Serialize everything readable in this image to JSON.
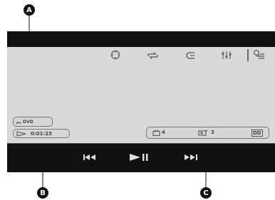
{
  "callouts": {
    "a": "A",
    "b": "B",
    "c": "C"
  },
  "disc": {
    "label": "DVD"
  },
  "status": {
    "elapsed": "0:01:23"
  },
  "info": {
    "title_count": "4",
    "chapter_number": "3",
    "format": "DD"
  },
  "top_icons": [
    "focus-icon",
    "repeat-icon",
    "shuffle-icon",
    "settings-sliders-icon",
    "options-menu-icon"
  ],
  "transport": [
    "previous-track-button",
    "play-pause-button",
    "next-track-button"
  ],
  "colors": {
    "screen_bg": "#d9d9d9",
    "bar_bg": "#111111",
    "icon_gray": "#6a6a6a",
    "transport_icon": "#e0e0e0",
    "callout": "#111111"
  }
}
